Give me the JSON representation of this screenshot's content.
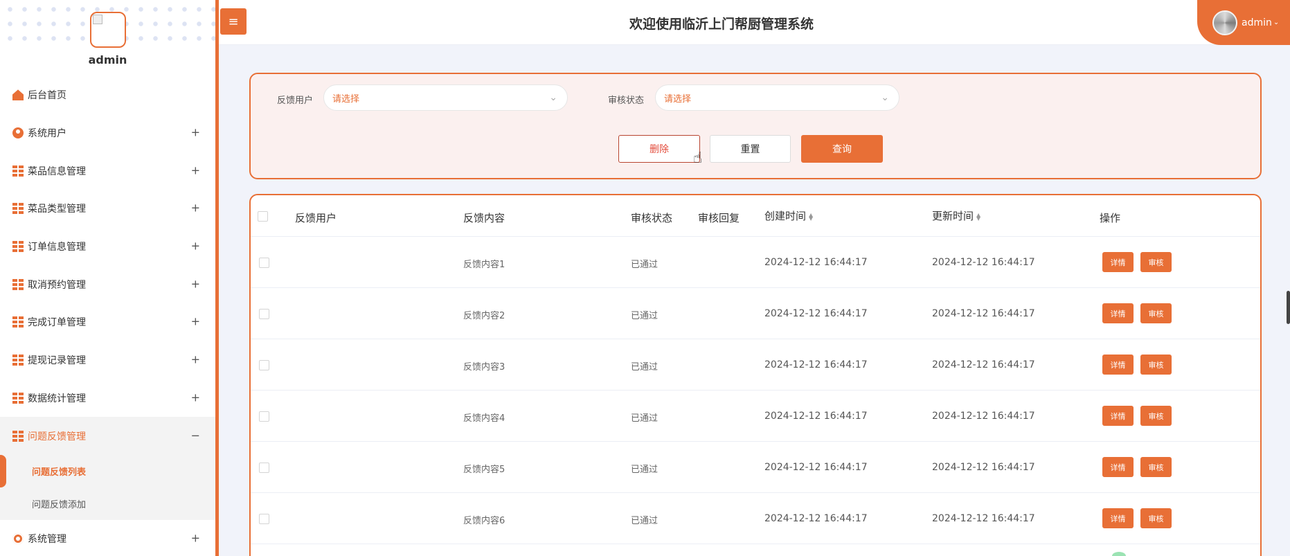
{
  "header": {
    "title": "欢迎使用临沂上门帮厨管理系统",
    "username": "admin",
    "menu_toggle": "≡",
    "caret": "⌄"
  },
  "sidebar": {
    "username": "admin",
    "items": [
      {
        "label": "后台首页",
        "icon": "home-icon",
        "expandable": false
      },
      {
        "label": "系统用户",
        "icon": "user-icon",
        "expandable": true
      },
      {
        "label": "菜品信息管理",
        "icon": "grid-icon",
        "expandable": true
      },
      {
        "label": "菜品类型管理",
        "icon": "grid-icon",
        "expandable": true
      },
      {
        "label": "订单信息管理",
        "icon": "grid-icon",
        "expandable": true
      },
      {
        "label": "取消预约管理",
        "icon": "grid-icon",
        "expandable": true
      },
      {
        "label": "完成订单管理",
        "icon": "grid-icon",
        "expandable": true
      },
      {
        "label": "提现记录管理",
        "icon": "grid-icon",
        "expandable": true
      },
      {
        "label": "数据统计管理",
        "icon": "grid-icon",
        "expandable": true
      },
      {
        "label": "问题反馈管理",
        "icon": "grid-icon",
        "expandable": true,
        "expanded": true
      },
      {
        "label": "系统管理",
        "icon": "gear-icon",
        "expandable": true
      }
    ],
    "subitems": [
      {
        "label": "问题反馈列表",
        "current": true
      },
      {
        "label": "问题反馈添加",
        "current": false
      }
    ],
    "plus": "+",
    "minus": "−"
  },
  "search": {
    "user_label": "反馈用户",
    "user_placeholder": "请选择",
    "status_label": "审核状态",
    "status_placeholder": "请选择",
    "delete_label": "删除",
    "reset_label": "重置",
    "query_label": "查询"
  },
  "table": {
    "columns": [
      "反馈用户",
      "反馈内容",
      "审核状态",
      "审核回复",
      "创建时间",
      "更新时间",
      "操作"
    ],
    "rows": [
      {
        "user": "",
        "content": "反馈内容1",
        "status": "已通过",
        "reply": "",
        "created": "2024-12-12 16:44:17",
        "updated": "2024-12-12 16:44:17"
      },
      {
        "user": "",
        "content": "反馈内容2",
        "status": "已通过",
        "reply": "",
        "created": "2024-12-12 16:44:17",
        "updated": "2024-12-12 16:44:17"
      },
      {
        "user": "",
        "content": "反馈内容3",
        "status": "已通过",
        "reply": "",
        "created": "2024-12-12 16:44:17",
        "updated": "2024-12-12 16:44:17"
      },
      {
        "user": "",
        "content": "反馈内容4",
        "status": "已通过",
        "reply": "",
        "created": "2024-12-12 16:44:17",
        "updated": "2024-12-12 16:44:17"
      },
      {
        "user": "",
        "content": "反馈内容5",
        "status": "已通过",
        "reply": "",
        "created": "2024-12-12 16:44:17",
        "updated": "2024-12-12 16:44:17"
      },
      {
        "user": "",
        "content": "反馈内容6",
        "status": "已通过",
        "reply": "",
        "created": "2024-12-12 16:44:17",
        "updated": "2024-12-12 16:44:17"
      }
    ],
    "detail_label": "详情",
    "audit_label": "审核"
  },
  "colors": {
    "accent": "#e86f36",
    "panel_bg": "#fbf0ef",
    "page_bg": "#f1f3fa",
    "delete_text": "#e34c3c"
  }
}
